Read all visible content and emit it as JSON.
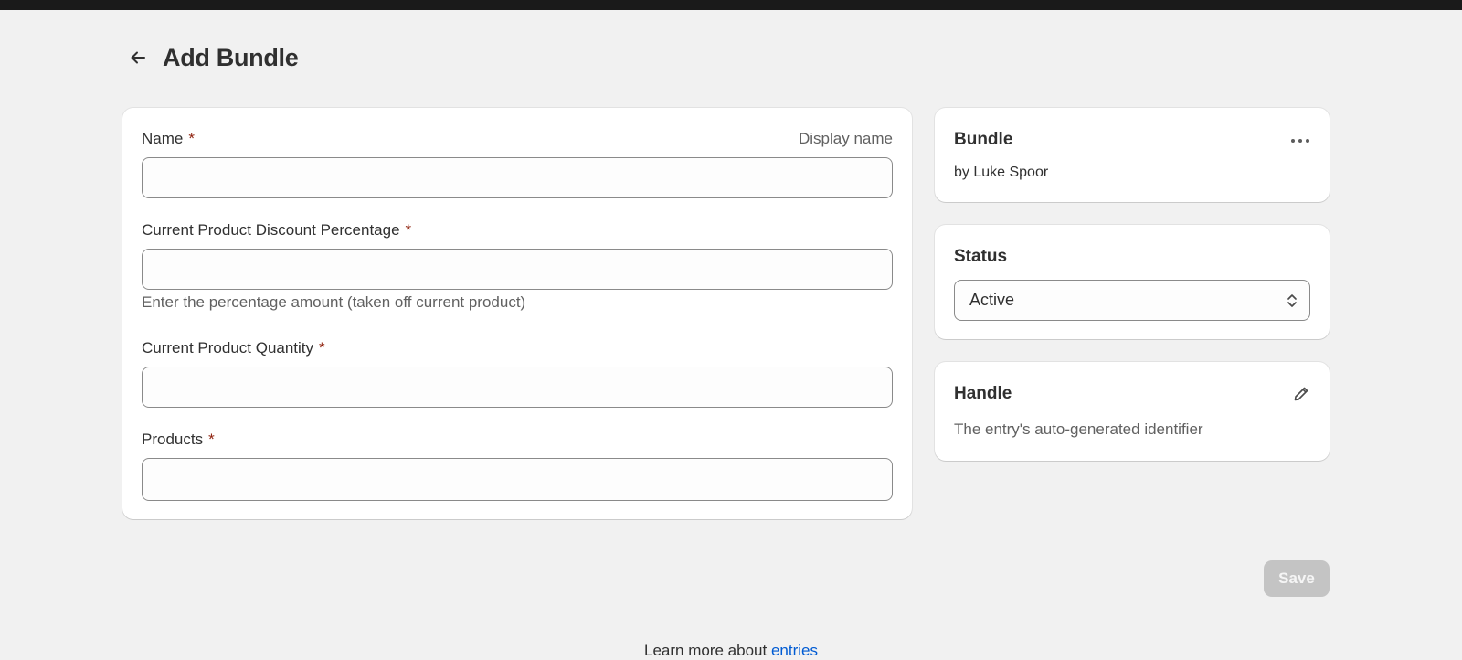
{
  "header": {
    "back_icon": "arrow-left-icon",
    "title": "Add Bundle"
  },
  "form": {
    "name": {
      "label": "Name",
      "required_mark": "*",
      "aside": "Display name",
      "value": ""
    },
    "discount": {
      "label": "Current Product Discount Percentage",
      "required_mark": "*",
      "value": "",
      "help": "Enter the percentage amount (taken off current product)"
    },
    "quantity": {
      "label": "Current Product Quantity",
      "required_mark": "*",
      "value": ""
    },
    "products": {
      "label": "Products",
      "required_mark": "*",
      "value": ""
    }
  },
  "bundle_card": {
    "title": "Bundle",
    "byline": "by Luke Spoor",
    "menu_icon": "more-horizontal-icon"
  },
  "status_card": {
    "title": "Status",
    "selected": "Active",
    "select_icon": "chevron-up-down-icon"
  },
  "handle_card": {
    "title": "Handle",
    "description": "The entry's auto-generated identifier",
    "edit_icon": "pencil-icon"
  },
  "actions": {
    "save_label": "Save"
  },
  "footer": {
    "text": "Learn more about ",
    "link_text": "entries"
  },
  "colors": {
    "background": "#f1f1f1",
    "topbar": "#1a1a1a",
    "required": "#8e1f0b",
    "link": "#005bd3",
    "save_disabled": "#c4c4c4"
  }
}
